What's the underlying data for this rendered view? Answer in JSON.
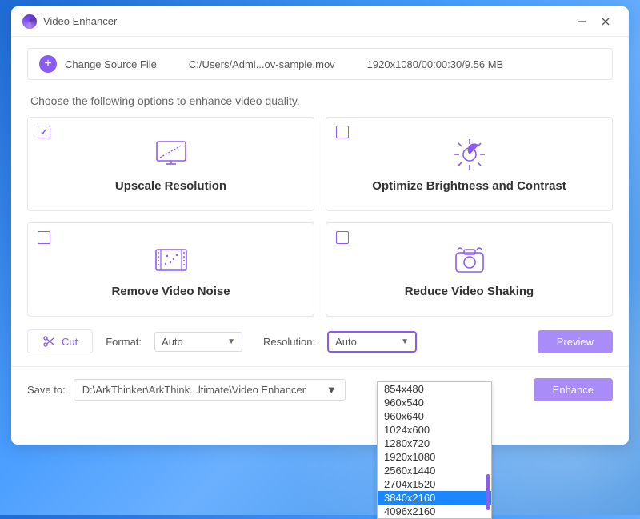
{
  "window": {
    "title": "Video Enhancer"
  },
  "source": {
    "change_label": "Change Source File",
    "path": "C:/Users/Admi...ov-sample.mov",
    "info": "1920x1080/00:00:30/9.56 MB"
  },
  "instruction": "Choose the following options to enhance video quality.",
  "cards": [
    {
      "label": "Upscale Resolution",
      "checked": true,
      "icon": "monitor-upscale-icon"
    },
    {
      "label": "Optimize Brightness and Contrast",
      "checked": false,
      "icon": "brightness-icon"
    },
    {
      "label": "Remove Video Noise",
      "checked": false,
      "icon": "film-noise-icon"
    },
    {
      "label": "Reduce Video Shaking",
      "checked": false,
      "icon": "camera-shake-icon"
    }
  ],
  "controls": {
    "cut_label": "Cut",
    "format_label": "Format:",
    "format_value": "Auto",
    "resolution_label": "Resolution:",
    "resolution_value": "Auto",
    "preview_label": "Preview"
  },
  "save": {
    "label": "Save to:",
    "path": "D:\\ArkThinker\\ArkThink...ltimate\\Video Enhancer",
    "enhance_label": "Enhance"
  },
  "resolution_dropdown": {
    "options": [
      "854x480",
      "960x540",
      "960x640",
      "1024x600",
      "1280x720",
      "1920x1080",
      "2560x1440",
      "2704x1520",
      "3840x2160",
      "4096x2160"
    ],
    "selected": "3840x2160"
  },
  "colors": {
    "accent": "#8a5cf6"
  }
}
